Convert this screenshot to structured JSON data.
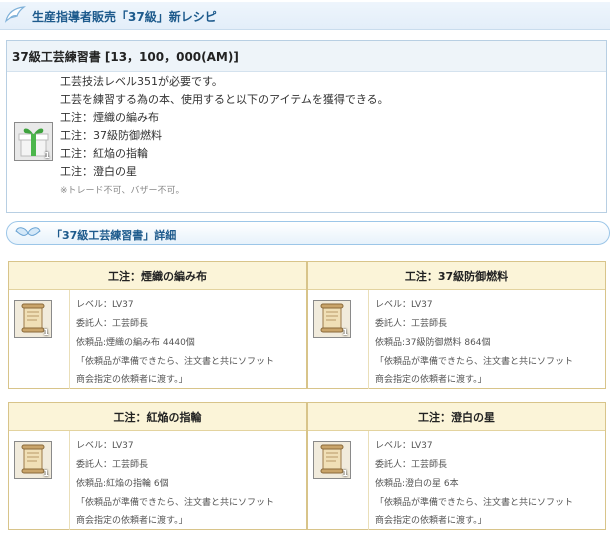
{
  "header": {
    "title": "生産指導者販売「37級」新レシピ"
  },
  "item": {
    "title": "37級工芸練習書 [13，100，000(AM)]",
    "lines": [
      "工芸技法レベル351が必要です。",
      "工芸を練習する為の本、使用すると以下のアイテムを獲得できる。",
      "工注：煙織の編み布",
      "工注：37級防御燃料",
      "工注：紅焔の指輪",
      "工注：澄白の星"
    ],
    "note": "※トレード不可、バザー不可。",
    "icon": "gift-box-icon",
    "icon_count": "1"
  },
  "detail": {
    "title": "「37級工芸練習書」詳細",
    "icon": "wings-icon"
  },
  "cards": [
    {
      "title": "工注：煙織の編み布",
      "level": "レベル：LV37",
      "client": "委託人：工芸師長",
      "material": "依頼品:煙織の編み布 4440個",
      "quote1": "「依頼品が準備できたら、注文書と共にソフット",
      "quote2": "商会指定の依頼者に渡す。」",
      "icon_count": "1"
    },
    {
      "title": "工注：37級防御燃料",
      "level": "レベル：LV37",
      "client": "委託人：工芸師長",
      "material": "依頼品:37級防御燃料 864個",
      "quote1": "「依頼品が準備できたら、注文書と共にソフット",
      "quote2": "商会指定の依頼者に渡す。」",
      "icon_count": "1"
    },
    {
      "title": "工注：紅焔の指輪",
      "level": "レベル：LV37",
      "client": "委託人：工芸師長",
      "material": "依頼品:紅焔の指輪 6個",
      "quote1": "「依頼品が準備できたら、注文書と共にソフット",
      "quote2": "商会指定の依頼者に渡す。」",
      "icon_count": "1"
    },
    {
      "title": "工注：澄白の星",
      "level": "レベル：LV37",
      "client": "委託人：工芸師長",
      "material": "依頼品:澄白の星 6本",
      "quote1": "「依頼品が準備できたら、注文書と共にソフット",
      "quote2": "商会指定の依頼者に渡す。」",
      "icon_count": "1"
    }
  ]
}
